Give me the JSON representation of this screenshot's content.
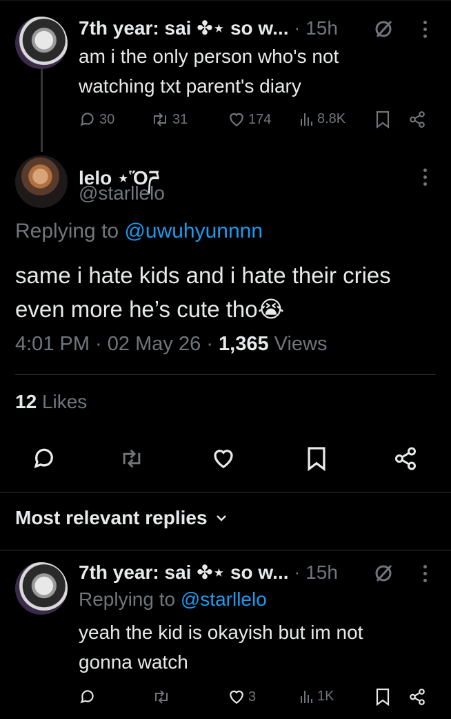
{
  "tweet1": {
    "name": "7th year: sai ✤⋆ so w...",
    "time": "15h",
    "text": "am i the only person who's not watching txt parent's diary",
    "replies": "30",
    "retweets": "31",
    "likes": "174",
    "views": "8.8K"
  },
  "main": {
    "name": "lelo ⋆Ὅཌ",
    "handle": "@starllelo",
    "replying_label": "Replying to",
    "replying_to": "@uwuhyunnnn",
    "text": "same i hate kids and i hate their cries even more he’s cute tho😭",
    "time": "4:01 PM",
    "date": "02 May 26",
    "views_count": "1,365",
    "views_label": "Views",
    "likes_count": "12",
    "likes_label": "Likes"
  },
  "replies_header": "Most relevant replies",
  "reply1": {
    "name": "7th year: sai ✤⋆ so w...",
    "time": "15h",
    "replying_label": "Replying to",
    "replying_to": "@starllelo",
    "text": "yeah the kid is okayish but im not gonna watch",
    "replies": "",
    "retweets": "",
    "likes": "3",
    "views": "1K"
  },
  "colors": {
    "background": "#000000",
    "text": "#e7e9ea",
    "muted": "#71767b",
    "link": "#1d9bf0",
    "divider": "#2f3336"
  }
}
